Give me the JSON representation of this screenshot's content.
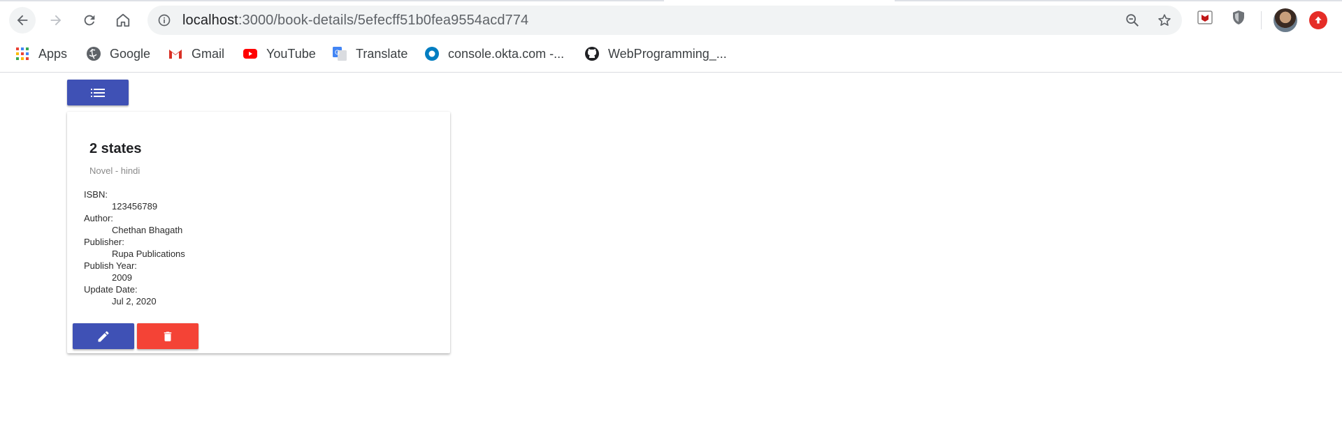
{
  "browser": {
    "url_host": "localhost",
    "url_path": ":3000/book-details/5efecff51b0fea9554acd774",
    "bookmarks": [
      {
        "label": "Apps",
        "icon": "apps-grid-icon"
      },
      {
        "label": "Google",
        "icon": "google-icon"
      },
      {
        "label": "Gmail",
        "icon": "gmail-icon"
      },
      {
        "label": "YouTube",
        "icon": "youtube-icon"
      },
      {
        "label": "Translate",
        "icon": "translate-icon"
      },
      {
        "label": "console.okta.com -...",
        "icon": "okta-icon"
      },
      {
        "label": "WebProgramming_...",
        "icon": "github-icon"
      }
    ]
  },
  "toolbar": {
    "list_button_icon": "list-icon"
  },
  "book": {
    "title": "2 states",
    "subtitle": "Novel - hindi",
    "fields": [
      {
        "label": "ISBN:",
        "value": "123456789"
      },
      {
        "label": "Author:",
        "value": "Chethan Bhagath"
      },
      {
        "label": "Publisher:",
        "value": "Rupa Publications"
      },
      {
        "label": "Publish Year:",
        "value": "2009"
      },
      {
        "label": "Update Date:",
        "value": "Jul 2, 2020"
      }
    ]
  },
  "actions": {
    "edit_icon": "pencil-icon",
    "delete_icon": "trash-icon"
  },
  "colors": {
    "primary": "#3f51b5",
    "warn": "#f44336"
  }
}
